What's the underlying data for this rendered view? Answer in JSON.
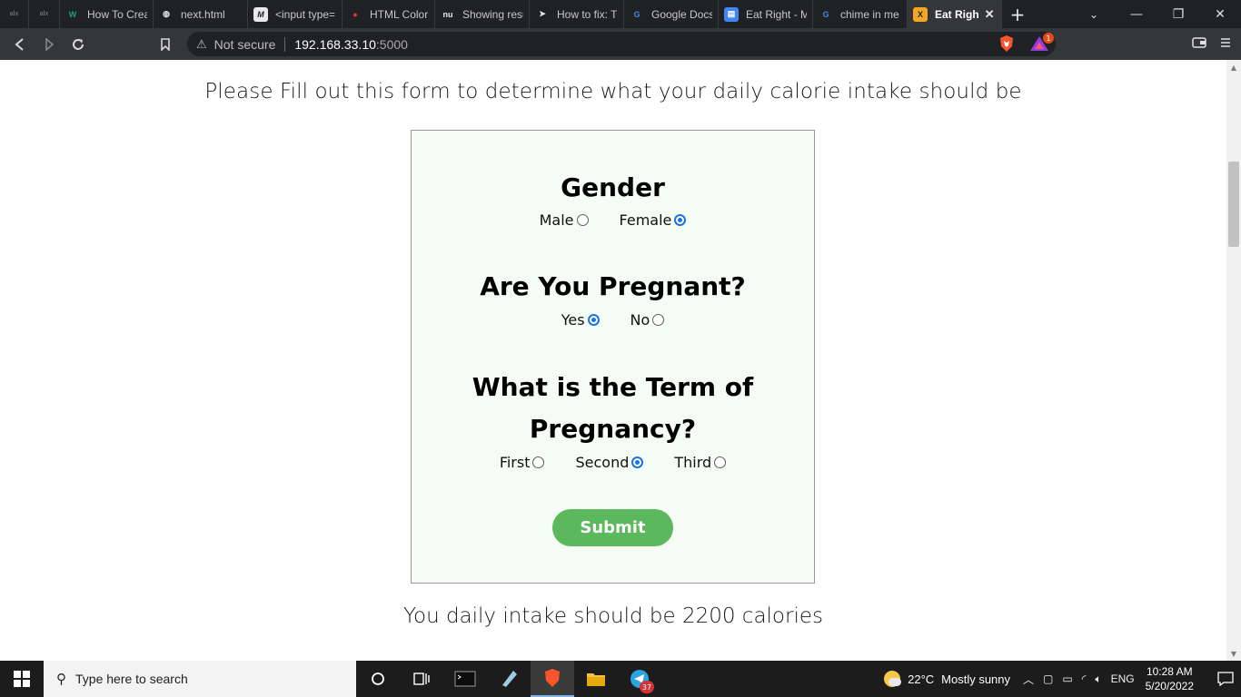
{
  "browser": {
    "tabs": [
      {
        "title": "",
        "favicon": "alx",
        "favicon_color": "#3b3b3b",
        "small": true
      },
      {
        "title": "",
        "favicon": "alx",
        "favicon_color": "#3b3b3b",
        "small": true
      },
      {
        "title": "How To Crea",
        "favicon": "W",
        "favicon_color": "#1ea366"
      },
      {
        "title": "next.html",
        "favicon": "globe",
        "favicon_color": "#e8e8e8"
      },
      {
        "title": "<input type=",
        "favicon": "M",
        "favicon_color": "#e8e8e8"
      },
      {
        "title": "HTML Color",
        "favicon": "rec",
        "favicon_color": "#e53935"
      },
      {
        "title": "Showing resu",
        "favicon": "nu",
        "favicon_color": "#e8e8e8"
      },
      {
        "title": "How to fix: T",
        "favicon": "rocket",
        "favicon_color": "#e8e8e8"
      },
      {
        "title": "Google Docs",
        "favicon": "G",
        "favicon_color": "#4285f4"
      },
      {
        "title": "Eat Right - M",
        "favicon": "doc",
        "favicon_color": "#4285f4"
      },
      {
        "title": "chime in me",
        "favicon": "G",
        "favicon_color": "#4285f4"
      },
      {
        "title": "Eat Righ",
        "favicon": "X",
        "favicon_color": "#f5a623",
        "active": true
      }
    ],
    "url": {
      "security_label": "Not secure",
      "host": "192.168.33.10",
      "port": ":5000"
    },
    "rewards_count": "1"
  },
  "page": {
    "intro": "Please Fill out this form to determine what your daily calorie intake should be",
    "questions": [
      {
        "title": "Gender",
        "options": [
          {
            "label": "Male",
            "checked": false
          },
          {
            "label": "Female",
            "checked": true
          }
        ]
      },
      {
        "title": "Are You Pregnant?",
        "options": [
          {
            "label": "Yes",
            "checked": true
          },
          {
            "label": "No",
            "checked": false
          }
        ]
      },
      {
        "title": "What is the Term of Pregnancy?",
        "options": [
          {
            "label": "First",
            "checked": false
          },
          {
            "label": "Second",
            "checked": true
          },
          {
            "label": "Third",
            "checked": false
          }
        ]
      }
    ],
    "submit_label": "Submit",
    "result": "You daily intake should be 2200 calories"
  },
  "taskbar": {
    "search_placeholder": "Type here to search",
    "weather": {
      "temp": "22°C",
      "condition": "Mostly sunny"
    },
    "language": "ENG",
    "time": "10:28 AM",
    "date": "5/20/2022",
    "telegram_badge": "37"
  },
  "colors": {
    "submit_bg": "#5cb85c",
    "form_bg": "#f5fcf5",
    "radio_checked": "#1a73e8",
    "tab_bar": "#202124",
    "toolbar": "#35363a"
  }
}
